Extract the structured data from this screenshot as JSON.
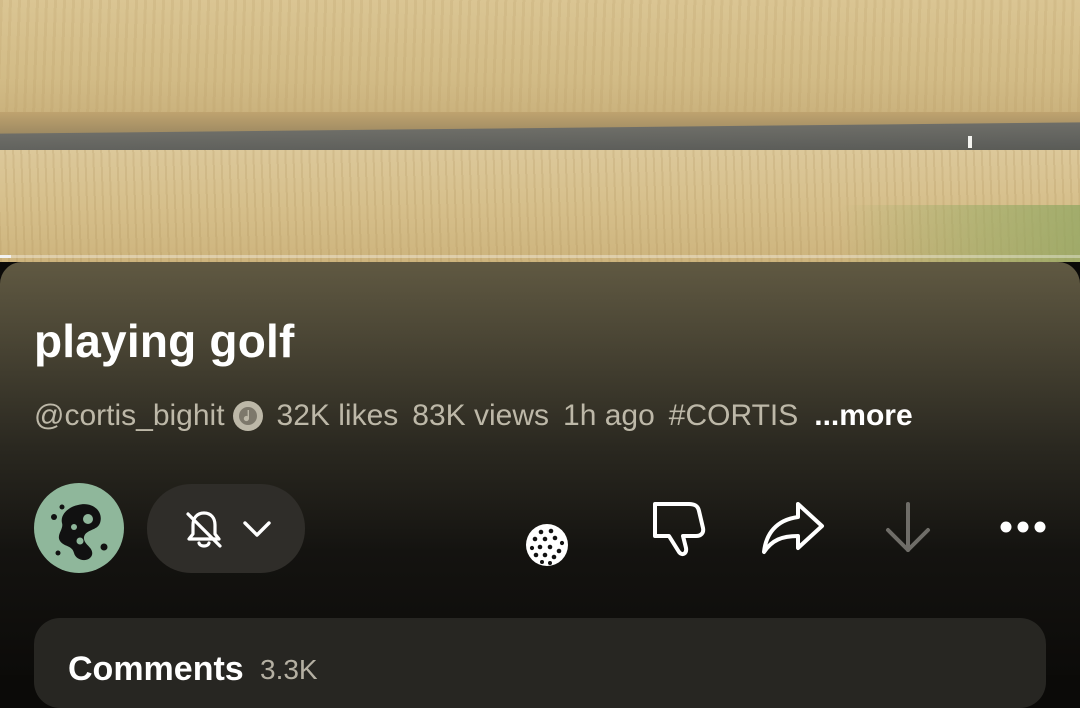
{
  "video": {
    "progress_fraction": 0.01
  },
  "info": {
    "title": "playing golf",
    "channel_handle": "@cortis_bighit",
    "likes": "32K likes",
    "views": "83K views",
    "age": "1h ago",
    "hashtag": "#CORTIS",
    "more_label": "...more"
  },
  "actions": {
    "icons": [
      "verified-music-icon",
      "notifications-off-icon",
      "chevron-down-icon",
      "golf-ball-icon",
      "dislike-icon",
      "share-icon",
      "download-icon",
      "more-options-icon"
    ]
  },
  "comments": {
    "label": "Comments",
    "count": "3.3K"
  },
  "colors": {
    "avatar_bg": "#8fb79b",
    "panel_top": "#605942",
    "pill_bg": "#2f2d29"
  }
}
